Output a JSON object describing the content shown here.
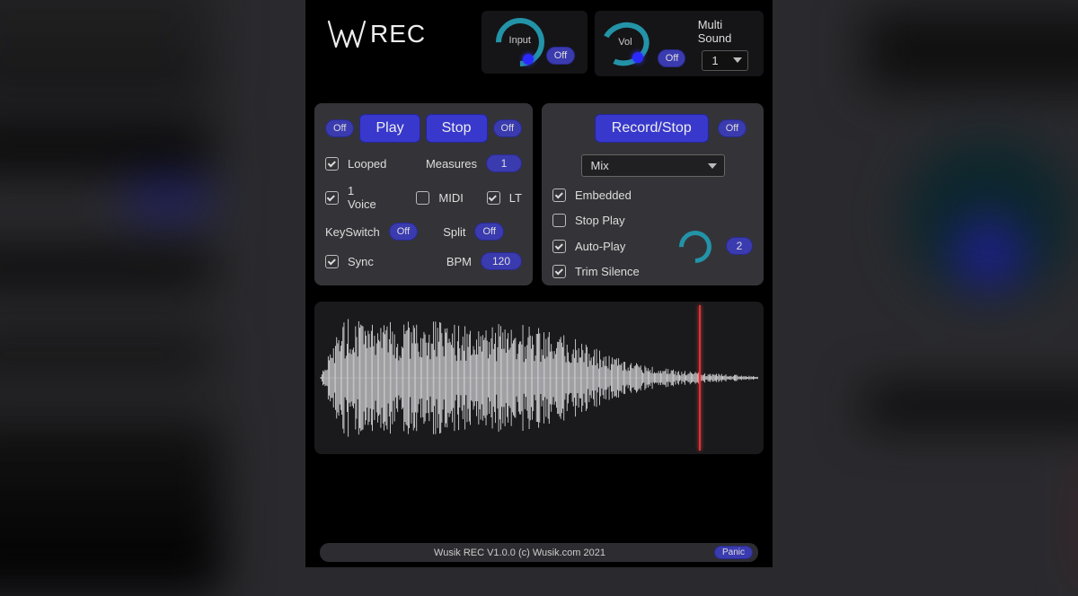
{
  "header": {
    "logo_text": "REC",
    "input_label": "Input",
    "input_off": "Off",
    "vol_label": "Vol",
    "vol_off": "Off",
    "multi_sound_label": "Multi Sound",
    "multi_sound_value": "1"
  },
  "play_card": {
    "off_left": "Off",
    "play": "Play",
    "stop": "Stop",
    "off_right": "Off",
    "looped": "Looped",
    "measures_label": "Measures",
    "measures_value": "1",
    "one_voice": "1 Voice",
    "midi": "MIDI",
    "lt": "LT",
    "keyswitch_label": "KeySwitch",
    "keyswitch_value": "Off",
    "split_label": "Split",
    "split_value": "Off",
    "sync": "Sync",
    "bpm_label": "BPM",
    "bpm_value": "120"
  },
  "rec_card": {
    "record_stop": "Record/Stop",
    "off_right": "Off",
    "mix_value": "Mix",
    "embedded": "Embedded",
    "stop_play": "Stop Play",
    "auto_play": "Auto-Play",
    "trim_silence": "Trim Silence",
    "trim_value": "2"
  },
  "footer": {
    "text": "Wusik REC V1.0.0 (c) Wusik.com 2021",
    "panic": "Panic"
  }
}
